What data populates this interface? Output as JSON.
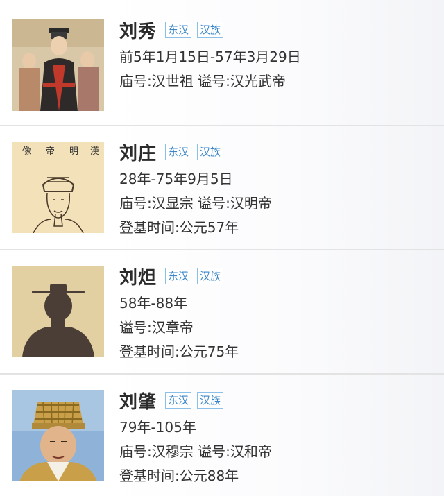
{
  "emperors": [
    {
      "name": "刘秀",
      "tags": [
        "东汉",
        "汉族"
      ],
      "lines": [
        "前5年1月15日-57年3月29日",
        "庙号:汉世祖 谥号:汉光武帝"
      ],
      "portrait": "painted-emperor-portrait"
    },
    {
      "name": "刘庄",
      "tags": [
        "东汉",
        "汉族"
      ],
      "lines": [
        "28年-75年9月5日",
        "庙号:汉显宗 谥号:汉明帝",
        "登基时间:公元57年"
      ],
      "portrait_caption": "漢 明 帝 像",
      "portrait": "sketch-emperor-portrait"
    },
    {
      "name": "刘炟",
      "tags": [
        "东汉",
        "汉族"
      ],
      "lines": [
        "58年-88年",
        "谥号:汉章帝",
        "登基时间:公元75年"
      ],
      "portrait": "silhouette-placeholder"
    },
    {
      "name": "刘肇",
      "tags": [
        "东汉",
        "汉族"
      ],
      "lines": [
        "79年-105年",
        "庙号:汉穆宗 谥号:汉和帝",
        "登基时间:公元88年"
      ],
      "portrait": "crowned-emperor-portrait"
    }
  ]
}
